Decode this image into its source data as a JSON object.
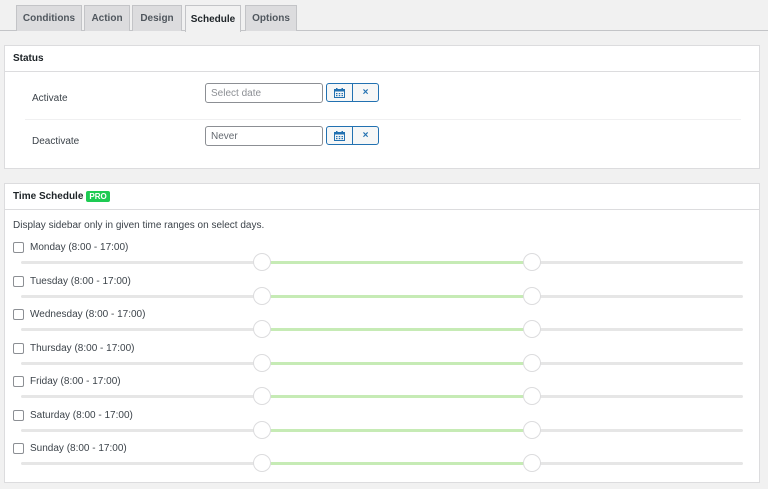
{
  "tabs": [
    {
      "label": "Conditions",
      "active": false
    },
    {
      "label": "Action",
      "active": false
    },
    {
      "label": "Design",
      "active": false
    },
    {
      "label": "Schedule",
      "active": true
    },
    {
      "label": "Options",
      "active": false
    }
  ],
  "status": {
    "title": "Status",
    "activate": {
      "label": "Activate",
      "placeholder": "Select date",
      "value": ""
    },
    "deactivate": {
      "label": "Deactivate",
      "placeholder": "",
      "value": "Never"
    },
    "calendar_icon": "calendar-icon",
    "clear_label": "×"
  },
  "time_schedule": {
    "title": "Time Schedule",
    "badge": "PRO",
    "badge_color": "#1ecb53",
    "range_color": "#c6ebb5",
    "description": "Display sidebar only in given time ranges on select days.",
    "days": [
      {
        "label": "Monday (8:00 - 17:00)",
        "checked": false,
        "start": 8,
        "end": 17
      },
      {
        "label": "Tuesday (8:00 - 17:00)",
        "checked": false,
        "start": 8,
        "end": 17
      },
      {
        "label": "Wednesday (8:00 - 17:00)",
        "checked": false,
        "start": 8,
        "end": 17
      },
      {
        "label": "Thursday (8:00 - 17:00)",
        "checked": false,
        "start": 8,
        "end": 17
      },
      {
        "label": "Friday (8:00 - 17:00)",
        "checked": false,
        "start": 8,
        "end": 17
      },
      {
        "label": "Saturday (8:00 - 17:00)",
        "checked": false,
        "start": 8,
        "end": 17
      },
      {
        "label": "Sunday (8:00 - 17:00)",
        "checked": false,
        "start": 8,
        "end": 17
      }
    ]
  }
}
